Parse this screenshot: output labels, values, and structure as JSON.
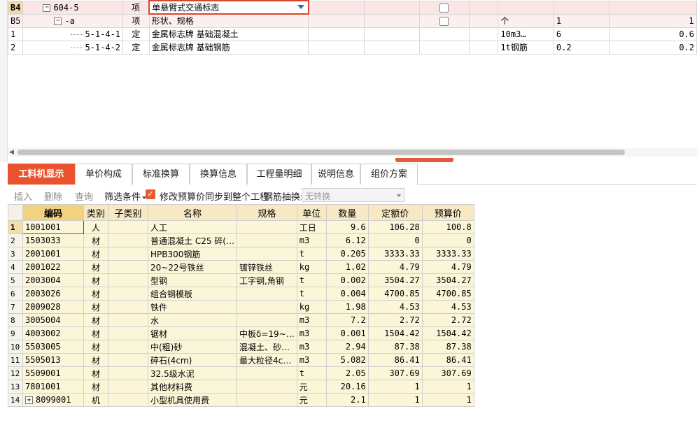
{
  "top_grid": {
    "rows": [
      {
        "rh": "B4",
        "code": "604-5",
        "type": "项",
        "name": "单悬臂式交通标志",
        "unit": "",
        "qty_expr": "",
        "qty": ""
      },
      {
        "rh": "B5",
        "code": "-a",
        "type": "项",
        "name": "形状、规格",
        "unit": "个",
        "qty_expr": "1",
        "qty": "1"
      },
      {
        "rh": "1",
        "code": "5-1-4-1",
        "type": "定",
        "name": "金属标志牌 基础混凝土",
        "unit": "10m3…",
        "qty_expr": "6",
        "qty": "0.6"
      },
      {
        "rh": "2",
        "code": "5-1-4-2",
        "type": "定",
        "name": "金属标志牌 基础钢筋",
        "unit": "1t钢筋",
        "qty_expr": "0.2",
        "qty": "0.2"
      }
    ]
  },
  "tabs": [
    "工料机显示",
    "单价构成",
    "标准换算",
    "换算信息",
    "工程量明细",
    "说明信息",
    "组价方案"
  ],
  "toolbar": {
    "insert": "插入",
    "delete": "删除",
    "query": "查询",
    "filter": "筛选条件",
    "sync_label": "修改预算价同步到整个工程",
    "rebar_label": "钢筋抽换:",
    "rebar_value": "无转换"
  },
  "material_table": {
    "headers": {
      "code": "编码",
      "cat": "类别",
      "subcat": "子类别",
      "name": "名称",
      "spec": "规格",
      "unit": "单位",
      "qty": "数量",
      "quota_price": "定额价",
      "budget_price": "预算价"
    },
    "rows": [
      {
        "n": "1",
        "code": "1001001",
        "cat": "人",
        "subcat": "",
        "name": "人工",
        "spec": "",
        "unit": "工日",
        "qty": "9.6",
        "quota_price": "106.28",
        "budget_price": "100.8"
      },
      {
        "n": "2",
        "code": "1503033",
        "cat": "材",
        "subcat": "",
        "name": "普通混凝土 C25 碎(…",
        "spec": "",
        "unit": "m3",
        "qty": "6.12",
        "quota_price": "0",
        "budget_price": "0"
      },
      {
        "n": "3",
        "code": "2001001",
        "cat": "材",
        "subcat": "",
        "name": "HPB300钢筋",
        "spec": "",
        "unit": "t",
        "qty": "0.205",
        "quota_price": "3333.33",
        "budget_price": "3333.33"
      },
      {
        "n": "4",
        "code": "2001022",
        "cat": "材",
        "subcat": "",
        "name": "20~22号铁丝",
        "spec": "镀锌铁丝",
        "unit": "kg",
        "qty": "1.02",
        "quota_price": "4.79",
        "budget_price": "4.79"
      },
      {
        "n": "5",
        "code": "2003004",
        "cat": "材",
        "subcat": "",
        "name": "型钢",
        "spec": "工字钢,角钢",
        "unit": "t",
        "qty": "0.002",
        "quota_price": "3504.27",
        "budget_price": "3504.27"
      },
      {
        "n": "6",
        "code": "2003026",
        "cat": "材",
        "subcat": "",
        "name": "组合钢模板",
        "spec": "",
        "unit": "t",
        "qty": "0.004",
        "quota_price": "4700.85",
        "budget_price": "4700.85"
      },
      {
        "n": "7",
        "code": "2009028",
        "cat": "材",
        "subcat": "",
        "name": "铁件",
        "spec": "",
        "unit": "kg",
        "qty": "1.98",
        "quota_price": "4.53",
        "budget_price": "4.53"
      },
      {
        "n": "8",
        "code": "3005004",
        "cat": "材",
        "subcat": "",
        "name": "水",
        "spec": "",
        "unit": "m3",
        "qty": "7.2",
        "quota_price": "2.72",
        "budget_price": "2.72"
      },
      {
        "n": "9",
        "code": "4003002",
        "cat": "材",
        "subcat": "",
        "name": "锯材",
        "spec": "中板δ=19~…",
        "unit": "m3",
        "qty": "0.001",
        "quota_price": "1504.42",
        "budget_price": "1504.42"
      },
      {
        "n": "10",
        "code": "5503005",
        "cat": "材",
        "subcat": "",
        "name": "中(粗)砂",
        "spec": "混凝土、砂…",
        "unit": "m3",
        "qty": "2.94",
        "quota_price": "87.38",
        "budget_price": "87.38"
      },
      {
        "n": "11",
        "code": "5505013",
        "cat": "材",
        "subcat": "",
        "name": "碎石(4cm)",
        "spec": "最大粒径4c…",
        "unit": "m3",
        "qty": "5.082",
        "quota_price": "86.41",
        "budget_price": "86.41"
      },
      {
        "n": "12",
        "code": "5509001",
        "cat": "材",
        "subcat": "",
        "name": "32.5级水泥",
        "spec": "",
        "unit": "t",
        "qty": "2.05",
        "quota_price": "307.69",
        "budget_price": "307.69"
      },
      {
        "n": "13",
        "code": "7801001",
        "cat": "材",
        "subcat": "",
        "name": "其他材料费",
        "spec": "",
        "unit": "元",
        "qty": "20.16",
        "quota_price": "1",
        "budget_price": "1"
      },
      {
        "n": "14",
        "code": "8099001",
        "cat": "机",
        "subcat": "",
        "name": "小型机具使用费",
        "spec": "",
        "unit": "元",
        "qty": "2.1",
        "quota_price": "1",
        "budget_price": "1"
      }
    ]
  }
}
